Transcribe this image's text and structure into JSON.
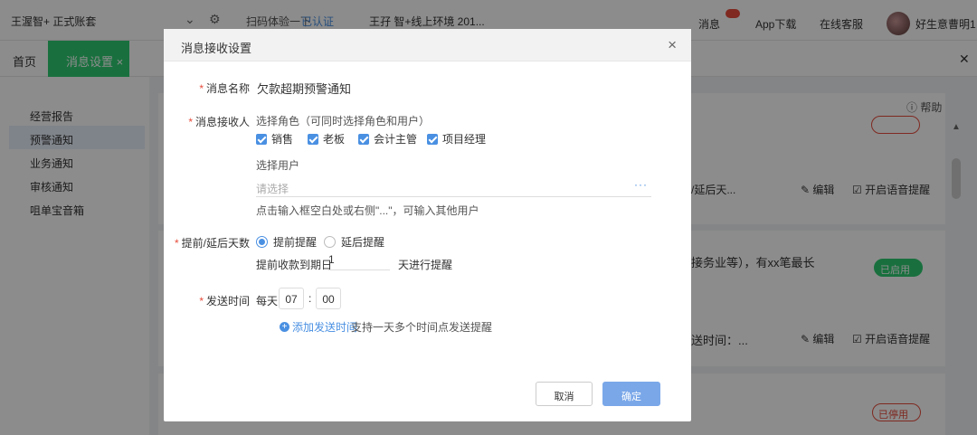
{
  "topbar": {
    "brand": "王渥智+ 正式账套",
    "scan_text": "扫码体验一下",
    "verified_text": "已认证",
    "env_text": "王孖 智+线上环境 201...",
    "message_label": "消息",
    "app_download": "App下载",
    "online_service": "在线客服",
    "user_name": "好生意曹明1"
  },
  "tabs": {
    "home": "首页",
    "active": "消息设置 ×"
  },
  "sidebar": {
    "items": [
      {
        "label": "经营报告"
      },
      {
        "label": "预警通知"
      },
      {
        "label": "业务通知"
      },
      {
        "label": "审核通知"
      },
      {
        "label": "咀单宝音箱"
      }
    ]
  },
  "background": {
    "help": "帮助",
    "row1_text": "/延后天...",
    "edit_label": "编辑",
    "voice_label": "开启语音提醒",
    "row2_text": "接务业等），有xx笔最长",
    "enabled_toggle": "已启用",
    "row3_text": "送时间：...",
    "edit_label_2": "编辑",
    "voice_label_2": "开启语音提醒",
    "disabled_toggle": "已停用"
  },
  "dialog": {
    "title": "消息接收设置",
    "name_label": "消息名称",
    "name_value": "欠款超期预警通知",
    "receiver_label": "消息接收人",
    "role_hint": "选择角色（可同时选择角色和用户）",
    "roles": [
      {
        "label": "销售"
      },
      {
        "label": "老板"
      },
      {
        "label": "会计主管"
      },
      {
        "label": "项目经理"
      }
    ],
    "user_section_label": "选择用户",
    "user_placeholder": "请选择",
    "user_dots": "···",
    "user_hint": "点击输入框空白处或右侧\"...\"，可输入其他用户",
    "days_label": "提前/延后天数",
    "radio_before": "提前提醒",
    "radio_after": "延后提醒",
    "before_due_prefix": "提前收款到期日",
    "days_value": "1",
    "days_suffix": "天进行提醒",
    "send_time_label": "发送时间",
    "every_day": "每天",
    "hour": "07",
    "colon": ":",
    "minute": "00",
    "add_time_label": "添加发送时间",
    "add_time_hint": "支持一天多个时间点发送提醒",
    "cancel": "取消",
    "confirm": "确定"
  }
}
